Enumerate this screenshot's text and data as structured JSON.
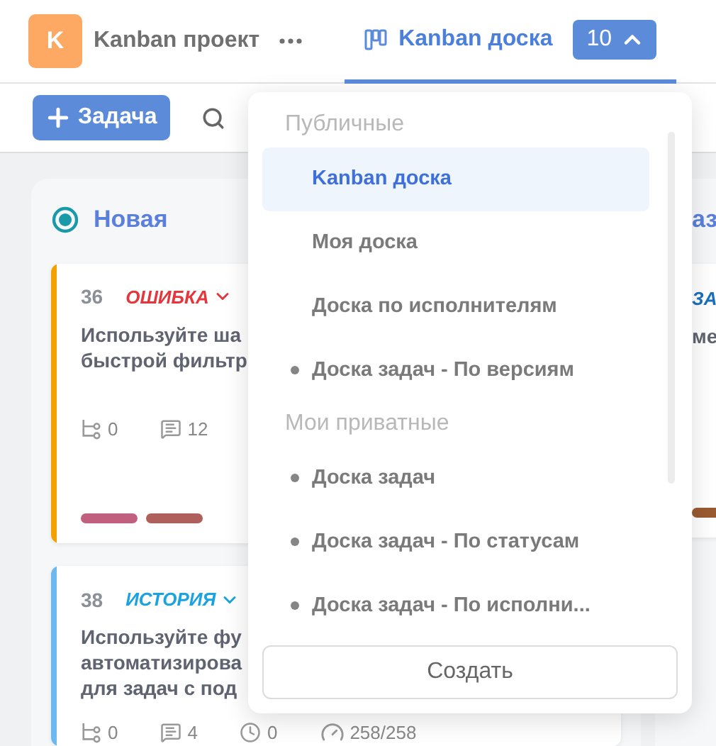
{
  "header": {
    "project_initial": "K",
    "project_name": "Kanban проект",
    "board": {
      "label": "Kanban доска",
      "count": "10",
      "expanded": true
    }
  },
  "toolbar": {
    "add_button": "Задача"
  },
  "columns": [
    {
      "title": "Новая",
      "cards": [
        {
          "number": "36",
          "type": {
            "text": "ОШИБКА",
            "color": "#e5363c"
          },
          "accent": {
            "color": "#f4a100"
          },
          "lines": [
            "Используйте ша",
            "быстрой фильтр"
          ],
          "stats": [
            {
              "kind": "subtasks",
              "value": "0"
            },
            {
              "kind": "comments",
              "value": "12"
            }
          ],
          "labels": [
            {
              "color": "#c0607e"
            },
            {
              "color": "#b0605a"
            }
          ]
        },
        {
          "number": "38",
          "type": {
            "text": "ИСТОРИЯ",
            "color": "#1aa3e0"
          },
          "accent": {
            "color": "#6cb8f0"
          },
          "lines": [
            "Используйте фу",
            "автоматизирова",
            "для задач с под"
          ],
          "stats": [
            {
              "kind": "subtasks",
              "value": "0"
            },
            {
              "kind": "comments",
              "value": "4"
            },
            {
              "kind": "time",
              "value": "0"
            },
            {
              "kind": "estimate",
              "value": "258/258"
            }
          ]
        }
      ]
    },
    {
      "title": "аз",
      "cards": [
        {
          "type": {
            "text": "ЗА",
            "color": "#1a6fc0"
          },
          "lines": [
            "ме"
          ],
          "labels": [
            {
              "color": "#9a5a32"
            }
          ]
        }
      ]
    }
  ],
  "dropdown": {
    "sections": [
      {
        "title": "Публичные",
        "items": [
          {
            "label": "Kanban доска",
            "selected": true,
            "dot": false
          },
          {
            "label": "Моя доска",
            "selected": false,
            "dot": false
          },
          {
            "label": "Доска по исполнителям",
            "selected": false,
            "dot": false
          },
          {
            "label": "Доска задач - По версиям",
            "selected": false,
            "dot": true
          }
        ]
      },
      {
        "title": "Мои приватные",
        "items": [
          {
            "label": "Доска задач",
            "selected": false,
            "dot": true
          },
          {
            "label": "Доска задач - По статусам",
            "selected": false,
            "dot": true
          },
          {
            "label": "Доска задач - По исполни...",
            "selected": false,
            "dot": true
          }
        ]
      }
    ],
    "create_button": "Создать"
  }
}
